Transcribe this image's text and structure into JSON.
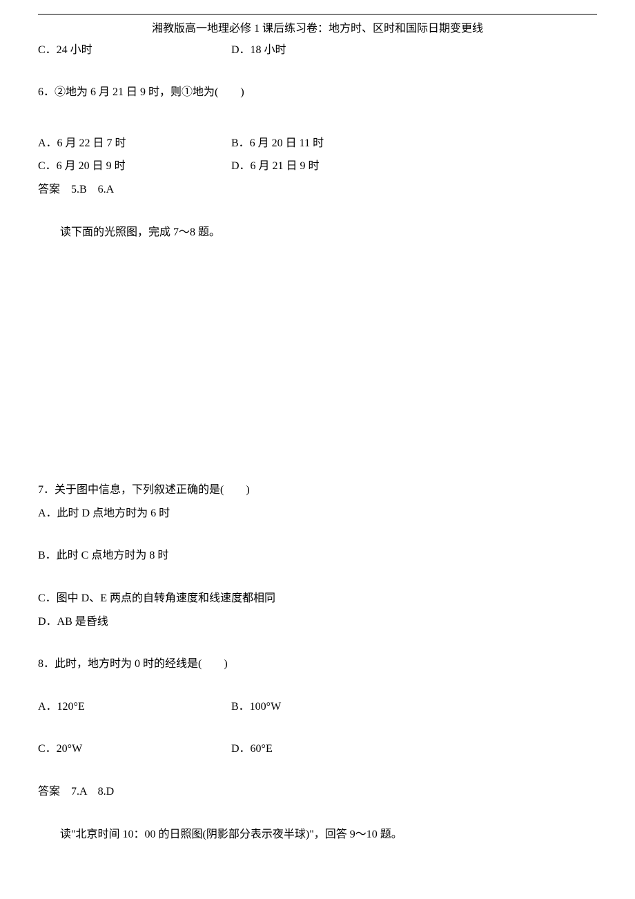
{
  "header": {
    "title": "湘教版高一地理必修 1 课后练习卷：地方时、区时和国际日期变更线"
  },
  "q5_options": {
    "c": "C．24 小时",
    "d": "D．18 小时"
  },
  "q6": {
    "stem": "6．②地为 6 月 21 日 9 时，则①地为(　　)",
    "a": "A．6 月 22 日 7 时",
    "b": "B．6 月 20 日 11 时",
    "c": "C．6 月 20 日 9 时",
    "d": "D．6 月 21 日 9 时"
  },
  "answers_5_6": "答案　5.B　6.A",
  "instruction_7_8": "读下面的光照图，完成 7～8 题。",
  "q7": {
    "stem": "7．关于图中信息，下列叙述正确的是(　　)",
    "a": "A．此时 D 点地方时为 6 时",
    "b": "B．此时 C 点地方时为 8 时",
    "c": "C．图中 D、E 两点的自转角速度和线速度都相同",
    "d": "D．AB 是昏线"
  },
  "q8": {
    "stem": "8．此时，地方时为 0 时的经线是(　　)",
    "a": "A．120°E",
    "b": "B．100°W",
    "c": "C．20°W",
    "d": "D．60°E"
  },
  "answers_7_8": "答案　7.A　8.D",
  "instruction_9_10": "读\"北京时间 10：00 的日照图(阴影部分表示夜半球)\"，回答 9～10 题。"
}
